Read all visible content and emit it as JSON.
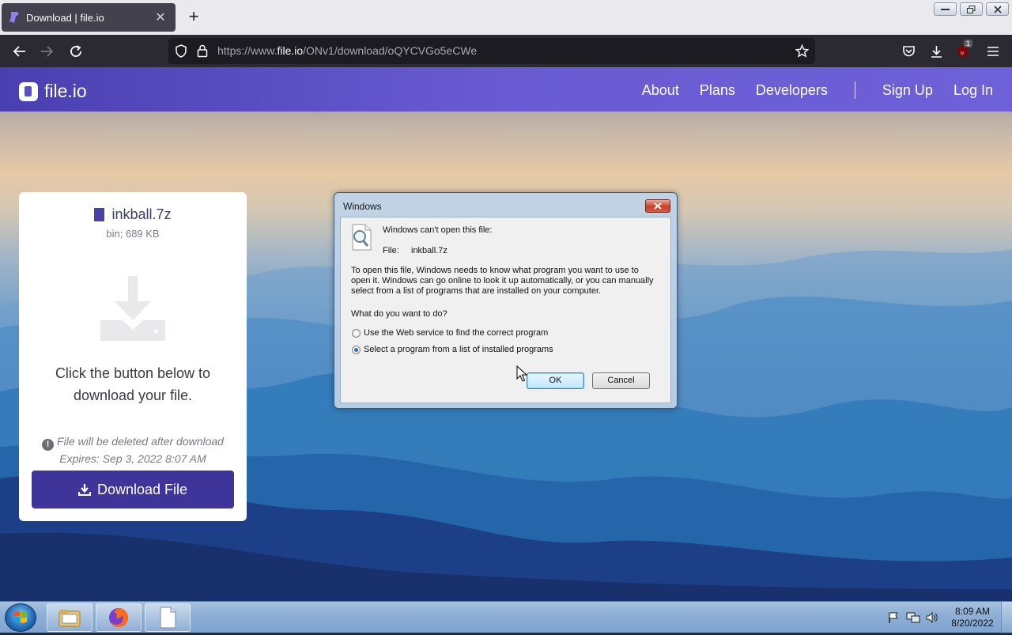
{
  "browser": {
    "tab_title": "Download | file.io",
    "url_prefix": "https://www.",
    "url_host": "file.io",
    "url_path": "/ONv1/download/oQYCVGo5eCWe",
    "extension_badge": "1"
  },
  "site": {
    "logo_text": "file.io",
    "nav": {
      "about": "About",
      "plans": "Plans",
      "developers": "Developers",
      "signup": "Sign Up",
      "login": "Log In"
    }
  },
  "card": {
    "filename": "inkball.7z",
    "meta": "bin; 689 KB",
    "message_line1": "Click the button below to",
    "message_line2": "download your file.",
    "warning": "File will be deleted after download",
    "expires": "Expires: Sep 3, 2022 8:07 AM",
    "download_label": "Download File"
  },
  "dialog": {
    "title": "Windows",
    "heading": "Windows can't open this file:",
    "file_label": "File:",
    "file_name": "inkball.7z",
    "paragraph_line1": "To open this file, Windows needs to know what program you want to use to",
    "paragraph_line2": "open it. Windows can go online to look it up automatically, or you can manually",
    "paragraph_line3": "select from a list of programs that are installed on your computer.",
    "question": "What do you want to do?",
    "options": [
      {
        "label": "Use the Web service to find the correct program",
        "selected": false
      },
      {
        "label": "Select a program from a list of installed programs",
        "selected": true
      }
    ],
    "ok_label": "OK",
    "cancel_label": "Cancel"
  },
  "taskbar": {
    "time": "8:09 AM",
    "date": "8/20/2022"
  },
  "colors": {
    "brand_purple": "#4b40a8",
    "download_button": "#3e3499",
    "browser_dark": "#2b2a33"
  }
}
